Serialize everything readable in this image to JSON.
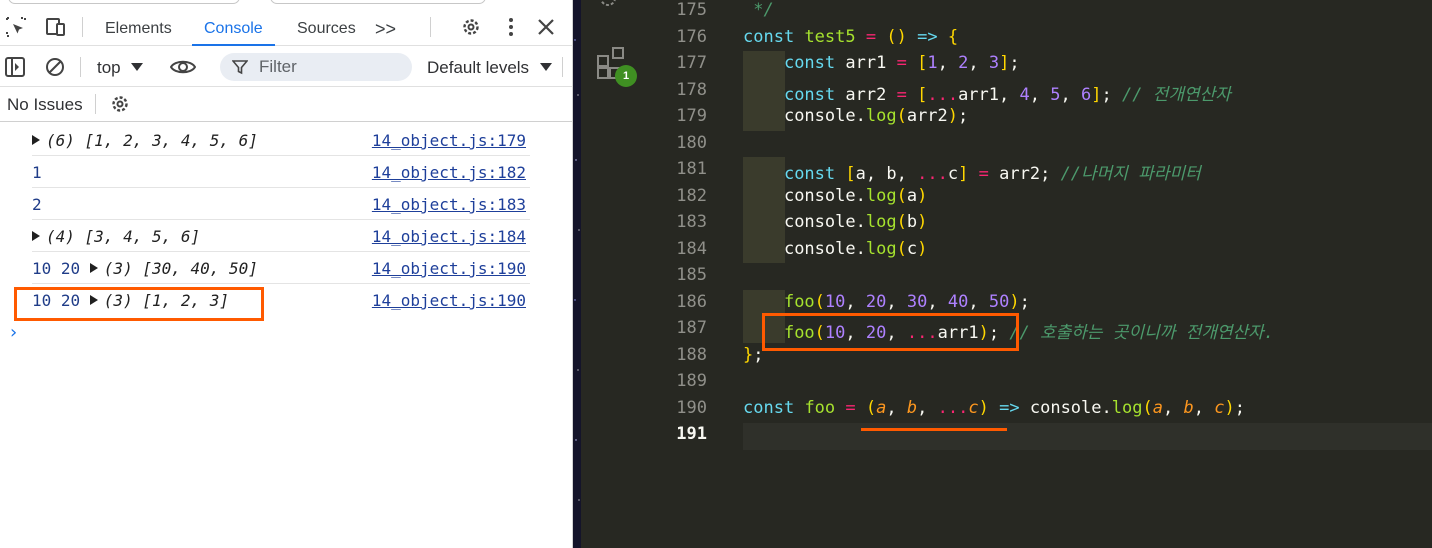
{
  "devtools": {
    "tabs": [
      {
        "label": "Elements"
      },
      {
        "label": "Console"
      },
      {
        "label": "Sources"
      }
    ],
    "more_tabs_glyph": ">>",
    "context": "top",
    "filter_placeholder": "Filter",
    "levels": "Default levels",
    "issues": "No Issues",
    "prompt": "›"
  },
  "console": {
    "rows": [
      {
        "expand": true,
        "prefix": "",
        "count": "(6)",
        "array": "[1, 2, 3, 4, 5, 6]",
        "plain": "",
        "source": "14_object.js:179"
      },
      {
        "expand": false,
        "prefix": "",
        "count": "",
        "array": "",
        "plain": "1",
        "source": "14_object.js:182"
      },
      {
        "expand": false,
        "prefix": "",
        "count": "",
        "array": "",
        "plain": "2",
        "source": "14_object.js:183"
      },
      {
        "expand": true,
        "prefix": "",
        "count": "(4)",
        "array": "[3, 4, 5, 6]",
        "plain": "",
        "source": "14_object.js:184"
      },
      {
        "expand": true,
        "prefix": "10 20 ",
        "count": "(3)",
        "array": "[30, 40, 50]",
        "plain": "",
        "source": "14_object.js:190"
      },
      {
        "expand": true,
        "prefix": "10 20 ",
        "count": "(3)",
        "array": "[1, 2, 3]",
        "plain": "",
        "source": "14_object.js:190"
      }
    ]
  },
  "editor": {
    "badge_count": "1",
    "current_line": "191",
    "lines": [
      {
        "num": "175",
        "text": " */"
      },
      {
        "num": "176",
        "text": "const test5 = () => {"
      },
      {
        "num": "177",
        "text": "    const arr1 = [1, 2, 3];"
      },
      {
        "num": "178",
        "text": "    const arr2 = [...arr1, 4, 5, 6]; // 전개연산자"
      },
      {
        "num": "179",
        "text": "    console.log(arr2);"
      },
      {
        "num": "180",
        "text": ""
      },
      {
        "num": "181",
        "text": "    const [a, b, ...c] = arr2; //나머지 파라미터"
      },
      {
        "num": "182",
        "text": "    console.log(a)"
      },
      {
        "num": "183",
        "text": "    console.log(b)"
      },
      {
        "num": "184",
        "text": "    console.log(c)"
      },
      {
        "num": "185",
        "text": ""
      },
      {
        "num": "186",
        "text": "    foo(10, 20, 30, 40, 50);"
      },
      {
        "num": "187",
        "text": "    foo(10, 20, ...arr1); // 호출하는 곳이니까 전개연산자."
      },
      {
        "num": "188",
        "text": "};"
      },
      {
        "num": "189",
        "text": ""
      },
      {
        "num": "190",
        "text": "const foo = (a, b, ...c) => console.log(a, b, c);"
      },
      {
        "num": "191",
        "text": ""
      }
    ]
  },
  "colors": {
    "accent": "#1a73e8",
    "highlight": "#ff5a00",
    "editor_bg": "#272822"
  }
}
